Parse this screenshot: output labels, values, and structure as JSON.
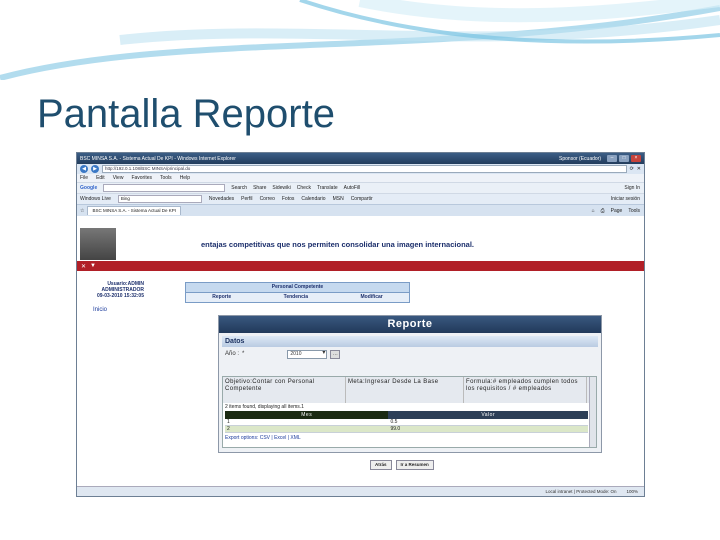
{
  "slide": {
    "title": "Pantalla Reporte"
  },
  "browser": {
    "window_title": "BSC MINSA S.A. - Sistema Actual De KPI - Windows Internet Explorer",
    "window_user": "Sponsor (Ecuador)",
    "url": "http://192.0.1.108/BSC MINSA/principal.do",
    "menu": [
      "File",
      "Edit",
      "View",
      "Favorites",
      "Tools",
      "Help"
    ],
    "google_label": "Google",
    "google_items": [
      "Search",
      "Share",
      "Sidewiki",
      "Check",
      "Translate",
      "AutoFill"
    ],
    "google_signin": "Sign In",
    "live_label": "Windows Live",
    "live_search": "Bing",
    "live_items": [
      "Novedades",
      "Perfil",
      "Correo",
      "Fotos",
      "Calendario",
      "MSN",
      "Compartir"
    ],
    "live_signin": "Iniciar sesión",
    "tab_label": "BSC MINSA S.A. - Sistema Actual De KPI",
    "tab_tools": [
      "Page",
      "Tools"
    ],
    "status_zone": "Local intranet | Protected Mode: On",
    "status_zoom": "100%"
  },
  "app": {
    "slogan": "entajas competitivas que nos permiten consolidar una imagen internacional.",
    "user_lines": [
      "Usuario:ADMIN",
      "ADMINISTRADOR",
      "09-03-2010 15:32:05"
    ],
    "inicio": "Inicio",
    "menu_header": "Personal Competente",
    "menu_options": [
      "Reporte",
      "Tendencia",
      "Modificar"
    ]
  },
  "report": {
    "title": "Reporte",
    "datos_label": "Datos",
    "year_label": "Año :",
    "year_required": "*",
    "year_value": "2010",
    "objective": "Objetivo:Contar con Personal Competente",
    "meta": "Meta:Ingresar Desde La Base",
    "formula": "Formula:# empleados cumplen todos los requisitos / # empleados",
    "items_found": "2 items found, displaying all items.1",
    "columns": [
      "Mes",
      "Valor"
    ],
    "rows": [
      {
        "mes": "1",
        "valor": "0.5"
      },
      {
        "mes": "2",
        "valor": "99.0"
      }
    ],
    "export_text": "Export options: CSV | Excel | XML",
    "buttons": [
      "Atrás",
      "Ir a Resumen"
    ]
  }
}
